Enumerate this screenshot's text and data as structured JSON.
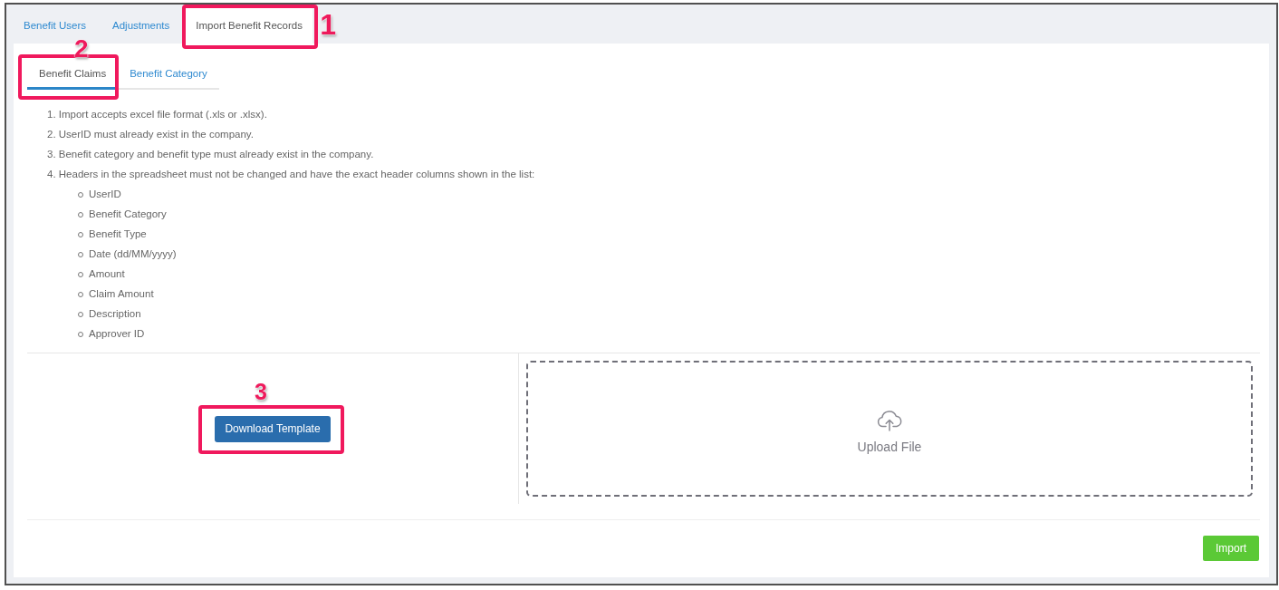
{
  "tabs": [
    {
      "label": "Benefit Users",
      "selected": false
    },
    {
      "label": "Adjustments",
      "selected": false
    },
    {
      "label": "Import Benefit Records",
      "selected": true,
      "callout": "1"
    }
  ],
  "sub_tabs": [
    {
      "label": "Benefit Claims",
      "selected": true,
      "callout": "2"
    },
    {
      "label": "Benefit Category",
      "selected": false
    }
  ],
  "instructions": [
    {
      "text": "1. Import accepts excel file format (.xls or .xlsx)."
    },
    {
      "text": "2. UserID must already exist in the company."
    },
    {
      "text": "3. Benefit category and benefit type must already exist in the company."
    },
    {
      "text": "4. Headers in the spreadsheet must not be changed and have the exact header columns shown in the list:",
      "columns": [
        "UserID",
        "Benefit Category",
        "Benefit Type",
        "Date (dd/MM/yyyy)",
        "Amount",
        "Claim Amount",
        "Description",
        "Approver ID"
      ]
    }
  ],
  "download_button": {
    "label": "Download Template",
    "callout": "3"
  },
  "upload": {
    "label": "Upload File"
  },
  "import_button": {
    "label": "Import"
  }
}
